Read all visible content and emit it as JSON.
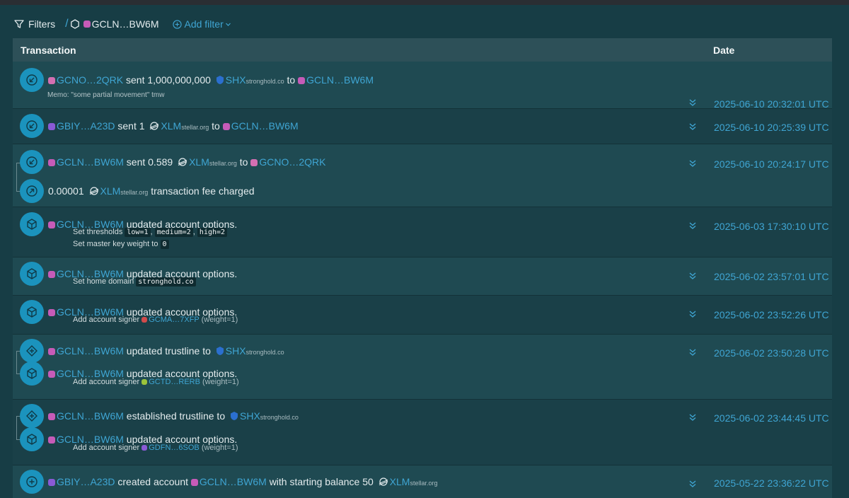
{
  "filters": {
    "label": "Filters",
    "slash": "/",
    "chip_account": "GCLN…BW6M",
    "add_filter": "Add filter"
  },
  "table": {
    "col_transaction": "Transaction",
    "col_date": "Date"
  },
  "rows": [
    {
      "ops": [
        {
          "from": "GCNO…2QRK",
          "verb": "sent 1,000,000,000",
          "asset": "SHX",
          "asset_domain": "stronghold.co",
          "to_word": "to",
          "to": "GCLN…BW6M",
          "memo": "Memo: \"some partial movement\" tmw"
        }
      ],
      "date": "2025-06-10 20:32:01 UTC"
    },
    {
      "ops": [
        {
          "from": "GBIY…A23D",
          "verb": "sent 1",
          "asset": "XLM",
          "asset_domain": "stellar.org",
          "to_word": "to",
          "to": "GCLN…BW6M"
        }
      ],
      "date": "2025-06-10 20:25:39 UTC"
    },
    {
      "ops": [
        {
          "from": "GCLN…BW6M",
          "verb": "sent 0.589",
          "asset": "XLM",
          "asset_domain": "stellar.org",
          "to_word": "to",
          "to": "GCNO…2QRK"
        },
        {
          "amount": "0.00001",
          "asset": "XLM",
          "asset_domain": "stellar.org",
          "suffix": "transaction fee charged"
        }
      ],
      "date": "2025-06-10 20:24:17 UTC"
    },
    {
      "ops": [
        {
          "from": "GCLN…BW6M",
          "verb": "updated account options.",
          "sub1_label": "Set thresholds",
          "th_low": "low=1",
          "th_medium": "medium=2",
          "th_high": "high=2",
          "sep": ",",
          "sub2_label": "Set master key weight to",
          "sub2_value": "0"
        }
      ],
      "date": "2025-06-03 17:30:10 UTC"
    },
    {
      "ops": [
        {
          "from": "GCLN…BW6M",
          "verb": "updated account options.",
          "sub1_label": "Set home domain",
          "sub1_value": "stronghold.co"
        }
      ],
      "date": "2025-06-02 23:57:01 UTC"
    },
    {
      "ops": [
        {
          "from": "GCLN…BW6M",
          "verb": "updated account options.",
          "sub1_label": "Add account signer",
          "signer": "GCMA…7XFP",
          "weight": "(weight=1)"
        }
      ],
      "date": "2025-06-02 23:52:26 UTC"
    },
    {
      "ops": [
        {
          "from": "GCLN…BW6M",
          "verb": "updated trustline to",
          "asset": "SHX",
          "asset_domain": "stronghold.co"
        },
        {
          "from": "GCLN…BW6M",
          "verb": "updated account options.",
          "sub1_label": "Add account signer",
          "signer": "GCTD…RERB",
          "weight": "(weight=1)"
        }
      ],
      "date": "2025-06-02 23:50:28 UTC"
    },
    {
      "ops": [
        {
          "from": "GCLN…BW6M",
          "verb": "established trustline to",
          "asset": "SHX",
          "asset_domain": "stronghold.co"
        },
        {
          "from": "GCLN…BW6M",
          "verb": "updated account options.",
          "sub1_label": "Add account signer",
          "signer": "GDFN…6SOB",
          "weight": "(weight=1)"
        }
      ],
      "date": "2025-06-02 23:44:45 UTC"
    },
    {
      "ops": [
        {
          "from": "GBIY…A23D",
          "verb": "created account",
          "to": "GCLN…BW6M",
          "mid": "with starting balance 50",
          "asset": "XLM",
          "asset_domain": "stellar.org"
        }
      ],
      "date": "2025-05-22 23:36:22 UTC"
    }
  ],
  "icons": {
    "filter": "filter-icon",
    "account_chip": "hexagon-icon",
    "add": "plus-circle-icon",
    "received": "arrow-down-left-icon",
    "fee": "arrow-up-right-icon",
    "options": "cube-icon",
    "trustline": "diamond-plus-icon",
    "create": "plus-icon",
    "expand": "chevron-double-down-icon"
  },
  "colors": {
    "background": "#173d45",
    "header": "#2d5058",
    "link": "#3fa5d3",
    "icon_badge": "#1b93bd"
  }
}
